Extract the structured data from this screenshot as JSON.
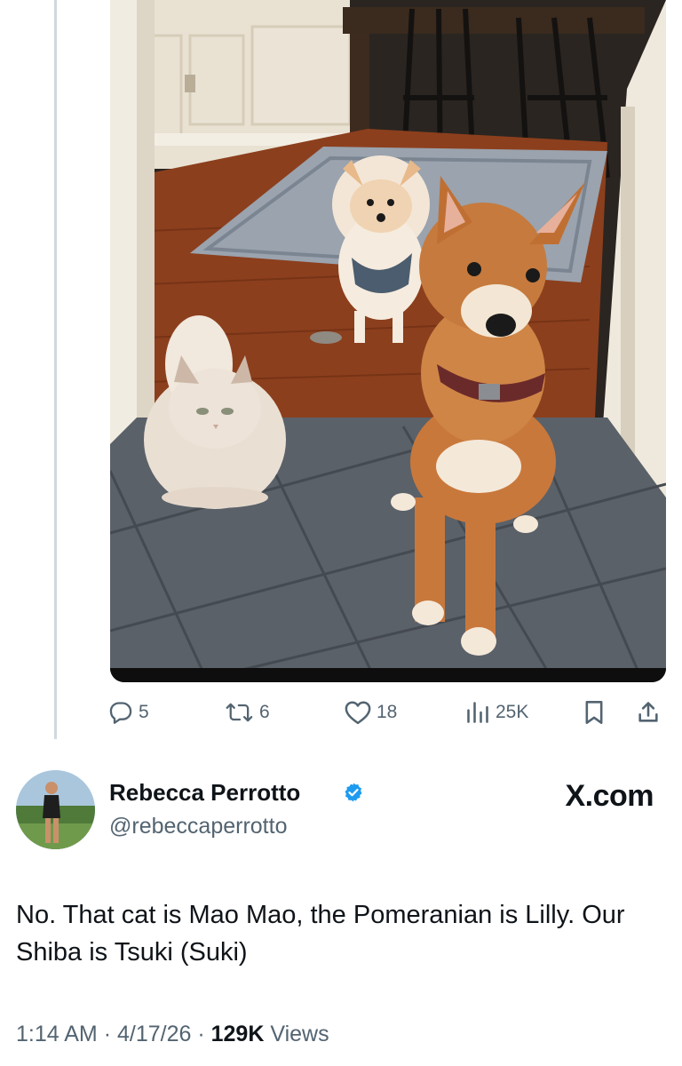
{
  "tweet": {
    "author_name": "Rebecca Perrotto",
    "handle": "@rebeccaperrotto",
    "text": "No. That cat is Mao Mao, the Pomeranian is Lilly. Our Shiba is Tsuki (Suki)",
    "time": "1:14 AM",
    "date": "4/17/26",
    "views_count": "129K",
    "views_label": "Views"
  },
  "parent_post": {
    "stats": {
      "replies": "5",
      "reposts": "6",
      "likes": "18",
      "views": "25K"
    }
  },
  "watermark": "X.com",
  "icons": {
    "reply": "reply-icon",
    "repost": "repost-icon",
    "like": "heart-icon",
    "views": "views-icon",
    "bookmark": "bookmark-icon",
    "share": "share-icon",
    "verified": "verified-badge-icon"
  },
  "colors": {
    "text_primary": "#0f1419",
    "text_secondary": "#536471",
    "verified_blue": "#1d9bf0",
    "thread_line": "#cfd9de"
  }
}
